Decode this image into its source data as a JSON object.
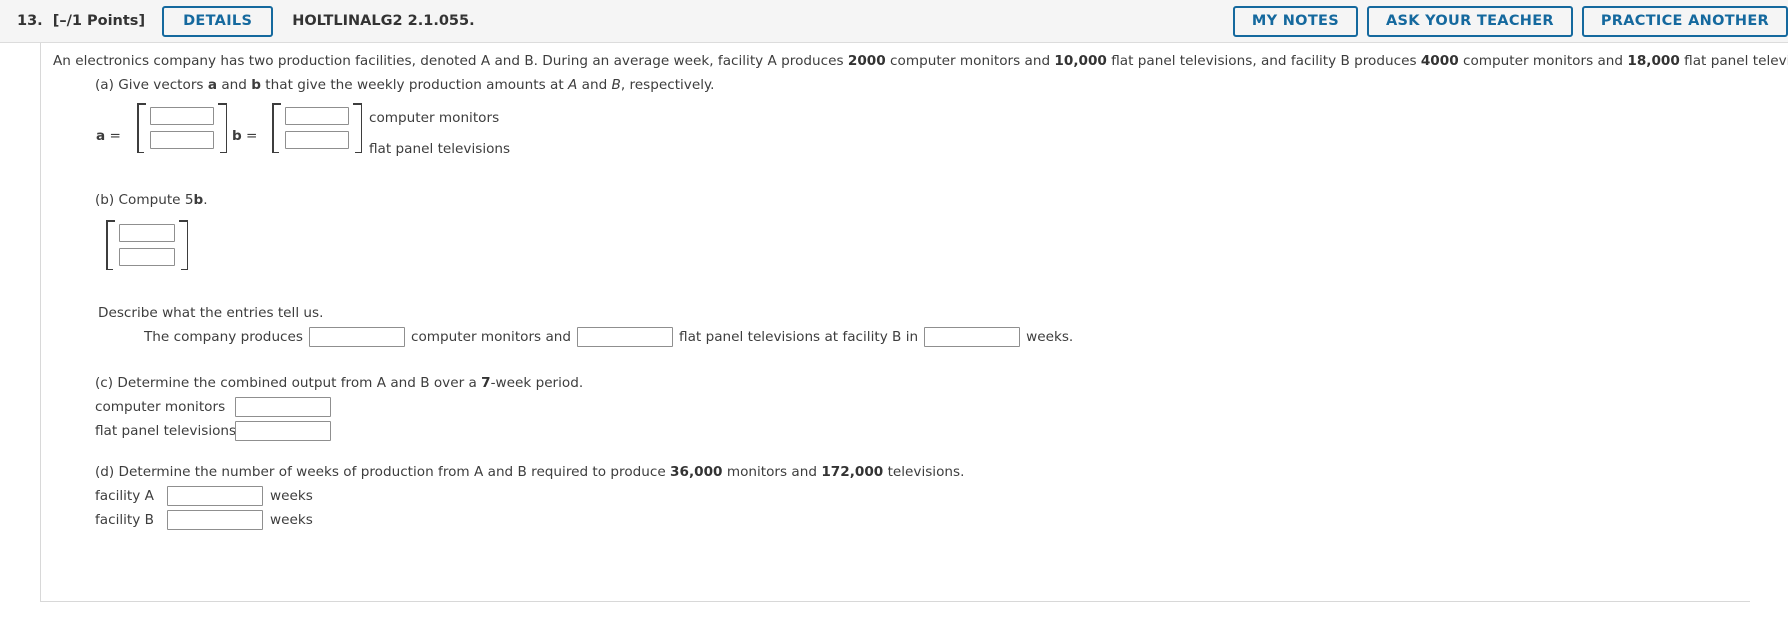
{
  "header": {
    "question_number": "13.",
    "points": "[–/1 Points]",
    "details_label": "DETAILS",
    "assignment_code": "HOLTLINALG2 2.1.055.",
    "actions": [
      {
        "label": "MY NOTES"
      },
      {
        "label": "ASK YOUR TEACHER"
      },
      {
        "label": "PRACTICE ANOTHER"
      }
    ]
  },
  "problem": {
    "stem_1": "An electronics company has two production facilities, denoted A and B. During an average week, facility A produces ",
    "stem_value_1": "2000",
    "stem_2": " computer monitors and ",
    "stem_value_2": "10,000",
    "stem_3": " flat panel televisions, and facility B produces ",
    "stem_value_3": "4000",
    "stem_4": " computer monitors and ",
    "stem_value_4": "18,000",
    "stem_5": " flat panel televisions."
  },
  "part_a": {
    "prompt_1": "(a) Give vectors ",
    "prompt_vec_a": "a",
    "prompt_2": " and ",
    "prompt_vec_b": "b",
    "prompt_3": " that give the weekly production amounts at ",
    "prompt_var_A": "A",
    "prompt_4": " and ",
    "prompt_var_B": "B",
    "prompt_5": ", respectively.",
    "label_a": "a",
    "equals_a": " =",
    "label_b": "b",
    "equals_b": " =",
    "row_label_1": "computer monitors",
    "row_label_2": "flat panel televisions",
    "a_cell_1": "",
    "a_cell_2": "",
    "b_cell_1": "",
    "b_cell_2": ""
  },
  "part_b": {
    "prompt_1": "(b) Compute 5",
    "prompt_vec": "b",
    "prompt_2": ".",
    "cell_1": "",
    "cell_2": "",
    "describe_prompt": "Describe what the entries tell us.",
    "sentence_1": "The company produces",
    "sentence_2": "computer monitors and",
    "sentence_3": "flat panel televisions at facility B in",
    "sentence_4": "weeks.",
    "blank_1": "",
    "blank_2": "",
    "blank_3": ""
  },
  "part_c": {
    "prompt_1": "(c) Determine the combined output from A and B over a ",
    "prompt_value": "7",
    "prompt_2": "-week period.",
    "label_1": "computer monitors",
    "label_2": "flat panel televisions",
    "value_1": "",
    "value_2": ""
  },
  "part_d": {
    "prompt_1": "(d) Determine the number of weeks of production from A and B required to produce ",
    "prompt_value_1": "36,000",
    "prompt_2": " monitors and ",
    "prompt_value_2": "172,000",
    "prompt_3": " televisions.",
    "label_1": "facility A",
    "label_2": "facility B",
    "unit_1": "weeks",
    "unit_2": "weeks",
    "value_1": "",
    "value_2": ""
  },
  "colors": {
    "accent": "#15699e",
    "header_bg": "#f5f5f5",
    "text": "#3d3d3d",
    "input_border": "#8f8f8f"
  }
}
